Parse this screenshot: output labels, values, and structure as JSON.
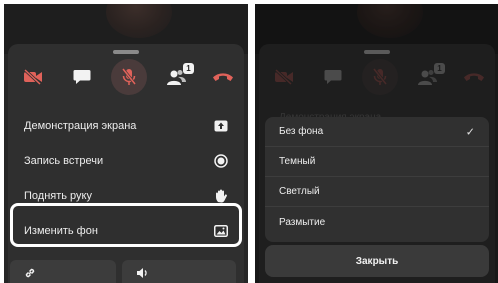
{
  "left_panel": {
    "controls": {
      "badge_count": "1"
    },
    "menu": [
      {
        "label": "Демонстрация экрана",
        "icon": "screen-share-icon"
      },
      {
        "label": "Запись встречи",
        "icon": "record-icon"
      },
      {
        "label": "Поднять руку",
        "icon": "raise-hand-icon"
      },
      {
        "label": "Изменить фон",
        "icon": "background-image-icon"
      }
    ]
  },
  "right_panel": {
    "faded_label": "Демонстрация экрана",
    "background_options": [
      {
        "label": "Без фона",
        "selected": true
      },
      {
        "label": "Темный",
        "selected": false
      },
      {
        "label": "Светлый",
        "selected": false
      },
      {
        "label": "Размытие",
        "selected": false
      }
    ],
    "check_mark": "✓",
    "close_label": "Закрыть"
  },
  "colors": {
    "panel": "#2f2f2f",
    "danger": "#e0625a",
    "text": "#ededed",
    "highlight": "#ffffff"
  }
}
